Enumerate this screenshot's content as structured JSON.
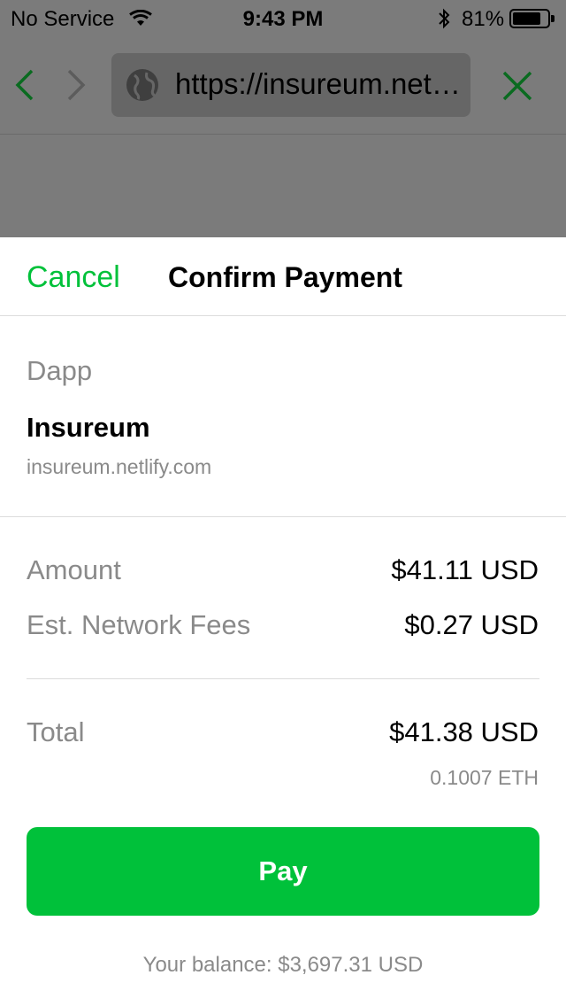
{
  "status_bar": {
    "carrier": "No Service",
    "time": "9:43 PM",
    "battery_percent": "81%",
    "battery_level": 0.81,
    "icons": [
      "wifi-icon",
      "bluetooth-icon",
      "battery-icon"
    ]
  },
  "browser": {
    "url": "https://insureum.netlify.com",
    "icons": [
      "back-arrow-icon",
      "forward-arrow-icon",
      "globe-icon",
      "close-icon"
    ]
  },
  "payment": {
    "cancel_label": "Cancel",
    "title": "Confirm Payment",
    "dapp_label": "Dapp",
    "dapp_name": "Insureum",
    "dapp_domain": "insureum.netlify.com",
    "rows": [
      {
        "label": "Amount",
        "value": "$41.11 USD"
      },
      {
        "label": "Est. Network Fees",
        "value": "$0.27 USD"
      }
    ],
    "total": {
      "label": "Total",
      "value": "$41.38 USD",
      "eth": "0.1007 ETH"
    },
    "pay_label": "Pay",
    "balance": "Your balance: $3,697.31 USD"
  },
  "colors": {
    "accent_green": "#00c13a",
    "nav_green": "#0a6b20",
    "secondary_text": "#8a8a8a",
    "overlay": "#7b7b7b"
  }
}
